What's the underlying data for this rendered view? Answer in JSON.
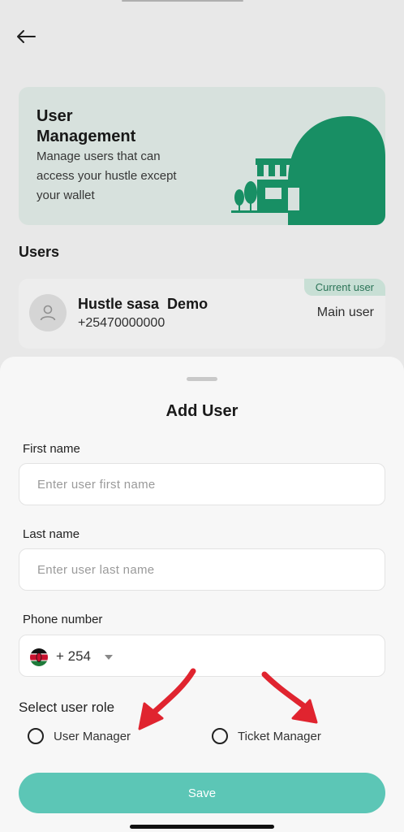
{
  "header": {
    "back_icon": "back-arrow-icon"
  },
  "banner": {
    "title": "User Management",
    "subtitle": "Manage users that can access your hustle except your wallet",
    "accent": "#1a9a6c"
  },
  "users": {
    "heading": "Users",
    "items": [
      {
        "name": "Hustle sasa  Demo",
        "phone": "+25470000000",
        "badge": "Current user",
        "role": "Main user"
      }
    ]
  },
  "sheet": {
    "title": "Add User",
    "first_name": {
      "label": "First name",
      "placeholder": "Enter user first name",
      "value": ""
    },
    "last_name": {
      "label": "Last name",
      "placeholder": "Enter user last name",
      "value": ""
    },
    "phone": {
      "label": "Phone number",
      "country_code": "+ 254",
      "value": ""
    },
    "role": {
      "heading": "Select user role",
      "options": [
        {
          "label": "User Manager",
          "selected": false
        },
        {
          "label": "Ticket Manager",
          "selected": false
        }
      ]
    },
    "save_label": "Save",
    "save_color": "#5cc6b6"
  }
}
